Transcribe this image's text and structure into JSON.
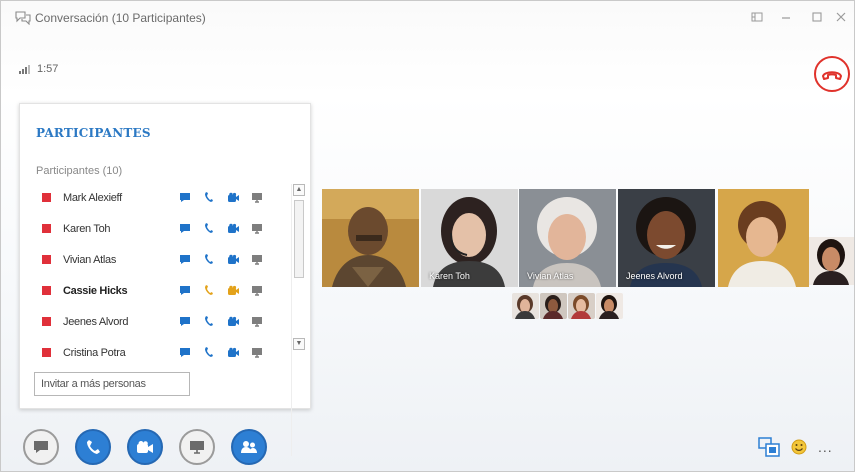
{
  "window": {
    "title": "Conversación (10 Participantes)",
    "controls": [
      "share-icon",
      "minimize-icon",
      "maximize-icon",
      "close-icon"
    ]
  },
  "status": {
    "timer": "1:57",
    "signal_icon": "signal-bars-icon"
  },
  "participants_panel": {
    "title": "PARTICIPANTES",
    "subtitle": "Participantes (10)",
    "invite_label": "Invitar a más personas",
    "items": [
      {
        "name": "Mark Alexieff",
        "bold": false,
        "presence_color": "#e0303a"
      },
      {
        "name": "Karen Toh",
        "bold": false,
        "presence_color": "#e0303a"
      },
      {
        "name": "Vivian Atlas",
        "bold": false,
        "presence_color": "#e0303a"
      },
      {
        "name": "Cassie Hicks",
        "bold": true,
        "presence_color": "#e0303a"
      },
      {
        "name": "Jeenes Alvord",
        "bold": false,
        "presence_color": "#e0303a"
      },
      {
        "name": "Cristina Potra",
        "bold": false,
        "presence_color": "#e0303a"
      }
    ],
    "row_icons": [
      "im-icon",
      "phone-icon",
      "video-icon",
      "screen-share-icon"
    ]
  },
  "video_tiles": [
    {
      "name": "",
      "icon": "avatar-bald-man"
    },
    {
      "name": "Karen Toh",
      "icon": "avatar-woman-headset"
    },
    {
      "name": "Vivian Atlas",
      "icon": "avatar-older-woman"
    },
    {
      "name": "Jeenes Alvord",
      "icon": "avatar-woman-smile"
    },
    {
      "name": "",
      "icon": "avatar-young-man"
    }
  ],
  "colors": {
    "accent_blue": "#2d7fd4",
    "panel_title": "#2c79c4",
    "presence_red": "#e0303a",
    "hangup_red": "#e0322b",
    "icon_blue": "#1f73c9",
    "icon_orange": "#e3a21a"
  },
  "bottom_toolbar": {
    "buttons": [
      "im-button",
      "call-button",
      "video-button",
      "present-button",
      "participants-button"
    ]
  },
  "bottom_right": {
    "icons": [
      "meeting-options-icon",
      "emoticon-icon",
      "more-options-icon"
    ],
    "more_label": "..."
  }
}
